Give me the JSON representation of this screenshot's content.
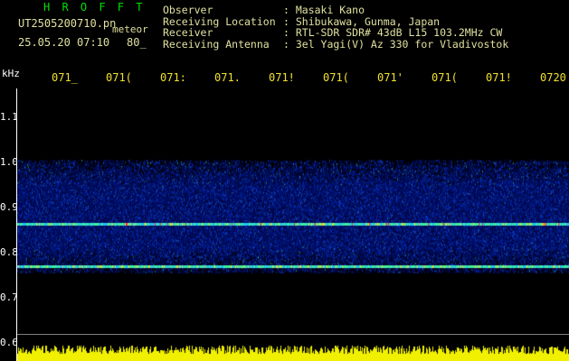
{
  "colors": {
    "background": "#000000",
    "brand": "#00e000",
    "header_text": "#e0e0a0",
    "axis": "#ffffff",
    "tick_label": "#ffffff",
    "time_label": "#f0e030",
    "signal_low": "#0010a0",
    "signal_mid": "#1050ff",
    "signal_high": "#40f0a0",
    "signal_peak": "#ff3030",
    "amplitude": "#f0f000"
  },
  "brand": "H R O F F T",
  "file": {
    "name": "UT2505200710.pn",
    "tag": "meteor",
    "date": "25.05.20 07:10",
    "number": "80_"
  },
  "meta": [
    {
      "label": "Observer",
      "value": ": Masaki Kano"
    },
    {
      "label": "Receiving Location",
      "value": ": Shibukawa, Gunma, Japan"
    },
    {
      "label": "Receiver",
      "value": ": RTL-SDR SDR# 43dB L15 103.2MHz CW"
    },
    {
      "label": "Receiving Antenna",
      "value": ": 3el Yagi(V) Az 330 for Vladivostok"
    }
  ],
  "axis": {
    "unit": "kHz",
    "y_ticks": [
      "1.1",
      "1.0",
      "0.9",
      "0.8",
      "0.7",
      "0.6"
    ],
    "time_ticks": [
      "071_",
      "071(",
      "071:",
      "071.",
      "071!",
      "071(",
      "071'",
      "071(",
      "071!",
      "0720"
    ]
  },
  "chart_data": {
    "type": "heatmap",
    "ylabel": "kHz",
    "x_ticks": [
      "071_",
      "071(",
      "071:",
      "071.",
      "071!",
      "071(",
      "071'",
      "071(",
      "071!",
      "0720"
    ],
    "y_ticks": [
      1.1,
      1.0,
      0.9,
      0.8,
      0.7,
      0.6
    ],
    "ylim": [
      0.6,
      1.15
    ],
    "noise_band_khz": [
      0.755,
      1.005
    ],
    "carrier_lines_khz": [
      0.865,
      0.77
    ],
    "grid": false
  }
}
